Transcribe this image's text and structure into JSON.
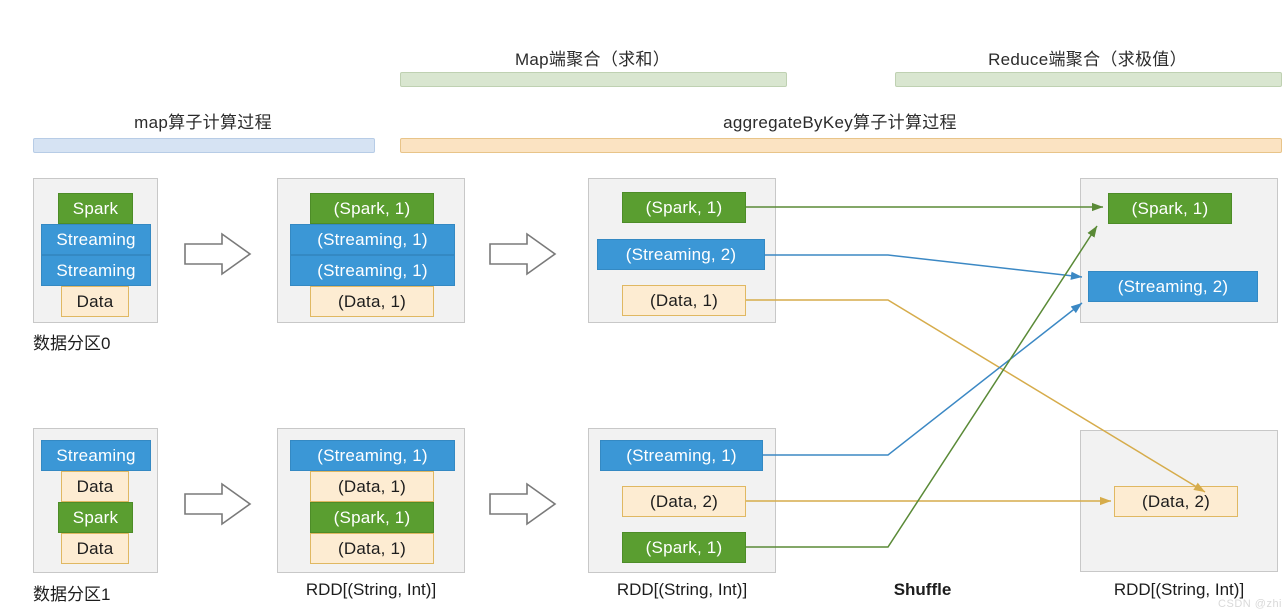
{
  "banners": [
    {
      "id": "map-agg",
      "label": "Map端聚合（求和）",
      "color": "#d9e6d0",
      "kind": "green"
    },
    {
      "id": "reduce-agg",
      "label": "Reduce端聚合（求极值）",
      "color": "#d9e6d0",
      "kind": "green"
    },
    {
      "id": "map-op",
      "label": "map算子计算过程",
      "color": "#d6e3f3",
      "kind": "blue"
    },
    {
      "id": "agg-op",
      "label": "aggregateByKey算子计算过程",
      "color": "#fbe3c2",
      "kind": "orange"
    }
  ],
  "columns": [
    {
      "id": "col1",
      "caption": "数据分区0",
      "caption_bottom": "数据分区1"
    },
    {
      "id": "col2",
      "caption": "",
      "caption_bottom": "RDD[(String, Int)]"
    },
    {
      "id": "col3",
      "caption": "",
      "caption_bottom": "RDD[(String, Int)]"
    },
    {
      "id": "col4",
      "caption": "",
      "caption_bottom": "RDD[(String, Int)]"
    }
  ],
  "shuffle_label": "Shuffle",
  "watermark": "CSDN @zhi",
  "stage1_top": {
    "title": "数据分区0",
    "items": [
      {
        "text": "Spark",
        "kind": "green"
      },
      {
        "text": "Streaming",
        "kind": "blue"
      },
      {
        "text": "Streaming",
        "kind": "blue"
      },
      {
        "text": "Data",
        "kind": "cream"
      }
    ]
  },
  "stage1_bottom": {
    "title": "数据分区1",
    "items": [
      {
        "text": "Streaming",
        "kind": "blue"
      },
      {
        "text": "Data",
        "kind": "cream"
      },
      {
        "text": "Spark",
        "kind": "green"
      },
      {
        "text": "Data",
        "kind": "cream"
      }
    ]
  },
  "stage2_top": {
    "title": "",
    "items": [
      {
        "text": "(Spark, 1)",
        "kind": "green"
      },
      {
        "text": "(Streaming, 1)",
        "kind": "blue"
      },
      {
        "text": "(Streaming, 1)",
        "kind": "blue"
      },
      {
        "text": "(Data, 1)",
        "kind": "cream"
      }
    ]
  },
  "stage2_bottom": {
    "title": "RDD[(String, Int)]",
    "items": [
      {
        "text": "(Streaming, 1)",
        "kind": "blue"
      },
      {
        "text": "(Data, 1)",
        "kind": "cream"
      },
      {
        "text": "(Spark, 1)",
        "kind": "green"
      },
      {
        "text": "(Data, 1)",
        "kind": "cream"
      }
    ]
  },
  "stage3_top": {
    "title": "",
    "items": [
      {
        "text": "(Spark, 1)",
        "kind": "green"
      },
      {
        "text": "(Streaming, 2)",
        "kind": "blue"
      },
      {
        "text": "(Data, 1)",
        "kind": "cream"
      }
    ]
  },
  "stage3_bottom": {
    "title": "RDD[(String, Int)]",
    "items": [
      {
        "text": "(Streaming, 1)",
        "kind": "blue"
      },
      {
        "text": "(Data, 2)",
        "kind": "cream"
      },
      {
        "text": "(Spark, 1)",
        "kind": "green"
      }
    ]
  },
  "stage4_top": {
    "title": "",
    "items": [
      {
        "text": "(Spark, 1)",
        "kind": "green"
      },
      {
        "text": "(Streaming,  2)",
        "kind": "blue"
      }
    ]
  },
  "stage4_bottom": {
    "title": "RDD[(String, Int)]",
    "items": [
      {
        "text": "(Data, 2)",
        "kind": "cream"
      }
    ]
  },
  "colors": {
    "green": "#5a9e30",
    "blue": "#3b97d6",
    "cream": "#fdecd2",
    "cream_border": "#e0b862",
    "arrow_green": "#5a8a37",
    "arrow_blue": "#3b88c4",
    "arrow_gold": "#d6ac4b",
    "frame_fill": "#f2f2f2",
    "frame_border": "#c8c8c8",
    "banner_green": "#d9e6d0",
    "banner_blue": "#d6e3f3",
    "banner_orange": "#fbe3c2"
  }
}
